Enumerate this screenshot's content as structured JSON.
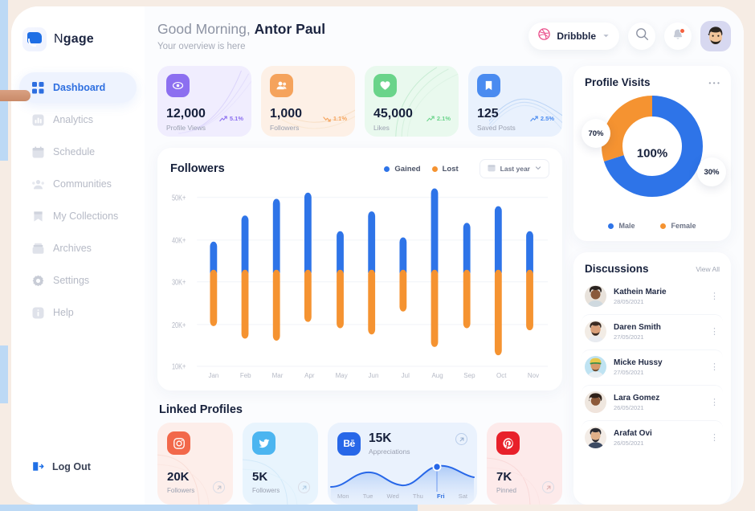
{
  "brand": {
    "name_light": "N",
    "name_bold": "gage",
    "logo_icon": "cast-signal-icon"
  },
  "sidebar": {
    "items": [
      {
        "label": "Dashboard",
        "icon": "grid-icon",
        "active": true
      },
      {
        "label": "Analytics",
        "icon": "bar-chart-icon",
        "active": false
      },
      {
        "label": "Schedule",
        "icon": "calendar-icon",
        "active": false
      },
      {
        "label": "Communities",
        "icon": "people-icon",
        "active": false
      },
      {
        "label": "My Collections",
        "icon": "bookmark-icon",
        "active": false
      },
      {
        "label": "Archives",
        "icon": "archive-icon",
        "active": false
      },
      {
        "label": "Settings",
        "icon": "gear-icon",
        "active": false
      },
      {
        "label": "Help",
        "icon": "info-icon",
        "active": false
      }
    ],
    "logout": {
      "label": "Log Out",
      "icon": "logout-icon"
    }
  },
  "header": {
    "greeting_prefix": "Good Morning, ",
    "user_name": "Antor Paul",
    "subtitle": "Your overview is here",
    "source": {
      "label": "Dribbble",
      "icon": "dribbble-icon",
      "chevron": "chevron-down-icon"
    },
    "search_icon": "search-icon",
    "bell_icon": "bell-icon",
    "avatar": "user-avatar"
  },
  "stats": [
    {
      "value": "12,000",
      "label": "Profile Views",
      "delta": "5.1%",
      "trend": "up",
      "icon": "eye-icon",
      "bg": "#f0edfe",
      "icon_bg": "#8c6ff0",
      "accent": "#8c6ff0"
    },
    {
      "value": "1,000",
      "label": "Followers",
      "delta": "1.1%",
      "trend": "down",
      "icon": "users-icon",
      "bg": "#fdf0e6",
      "icon_bg": "#f5a35c",
      "accent": "#f5a35c"
    },
    {
      "value": "45,000",
      "label": "Likes",
      "delta": "2.1%",
      "trend": "up",
      "icon": "heart-icon",
      "bg": "#e9f9ee",
      "icon_bg": "#6ad48a",
      "accent": "#6ad48a"
    },
    {
      "value": "125",
      "label": "Saved Posts",
      "delta": "2.5%",
      "trend": "up",
      "icon": "bookmark-icon",
      "bg": "#e9f1fd",
      "icon_bg": "#4a8bf0",
      "accent": "#4a8bf0"
    }
  ],
  "followers_card": {
    "title": "Followers",
    "legend": [
      {
        "label": "Gained",
        "color": "#2e74e8"
      },
      {
        "label": "Lost",
        "color": "#f59331"
      }
    ],
    "range": {
      "label": "Last year",
      "icon": "calendar-icon",
      "chevron": "chevron-down-icon"
    }
  },
  "chart_data": {
    "type": "bar",
    "title": "Followers",
    "xlabel": "",
    "ylabel": "",
    "ylim": [
      10000,
      52000
    ],
    "yticks": [
      50000,
      40000,
      30000,
      20000,
      10000
    ],
    "ytick_labels": [
      "50K+",
      "40K+",
      "30K+",
      "20K+",
      "10K+"
    ],
    "grid": false,
    "legend_position": "top-right",
    "split_value": 32000,
    "categories": [
      "Jan",
      "Feb",
      "Mar",
      "Apr",
      "May",
      "Jun",
      "Jul",
      "Aug",
      "Sep",
      "Oct",
      "Nov"
    ],
    "series": [
      {
        "name": "Gained",
        "color": "#2e74e8",
        "values": [
          37500,
          43500,
          47500,
          49000,
          40000,
          44500,
          38500,
          50500,
          42000,
          46000,
          40000
        ]
      },
      {
        "name": "Lost",
        "color": "#f59331",
        "values": [
          20500,
          17500,
          17000,
          21500,
          20000,
          18500,
          24000,
          15500,
          20000,
          13500,
          19500
        ]
      }
    ]
  },
  "linked_profiles": {
    "title": "Linked Profiles",
    "items": [
      {
        "network": "Instagram",
        "icon": "instagram-icon",
        "value": "20K",
        "label": "Followers",
        "bg": "#fdeeea",
        "icon_bg": "#f2684a",
        "type": "small"
      },
      {
        "network": "Twitter",
        "icon": "twitter-icon",
        "value": "5K",
        "label": "Followers",
        "bg": "#e8f4fd",
        "icon_bg": "#4cb5f0",
        "type": "small"
      },
      {
        "network": "Behance",
        "icon": "behance-icon",
        "value": "15K",
        "label": "Appreciations",
        "bg": "#eaf2fd",
        "icon_bg": "#2767e8",
        "type": "wide",
        "days": [
          "Mon",
          "Tue",
          "Wed",
          "Thu",
          "Fri",
          "Sat"
        ],
        "active_day": "Fri"
      },
      {
        "network": "Pinterest",
        "icon": "pinterest-icon",
        "value": "7K",
        "label": "Pinned",
        "bg": "#fdeaea",
        "icon_bg": "#e8202a",
        "type": "small"
      }
    ]
  },
  "profile_visits": {
    "title": "Profile Visits",
    "more_icon": "more-horizontal-icon",
    "center_value": "100%",
    "segments": [
      {
        "label": "Male",
        "percent": "70%",
        "value": 70,
        "color": "#2e74e8"
      },
      {
        "label": "Female",
        "percent": "30%",
        "value": 30,
        "color": "#f59331"
      }
    ]
  },
  "discussions": {
    "title": "Discussions",
    "action_label": "View All",
    "items": [
      {
        "name": "Kathein Marie",
        "date": "28/05/2021",
        "avatar_bg": "#e8e2db",
        "skin": "#8a5a3c",
        "hair": "#2a2320"
      },
      {
        "name": "Daren Smith",
        "date": "27/05/2021",
        "avatar_bg": "#f2ece5",
        "skin": "#d9a07a",
        "hair": "#3b2b22"
      },
      {
        "name": "Micke Hussy",
        "date": "27/05/2021",
        "avatar_bg": "#bfe3f2",
        "skin": "#d79a6a",
        "hair": "#e8c84a"
      },
      {
        "name": "Lara Gomez",
        "date": "26/05/2021",
        "avatar_bg": "#efe7df",
        "skin": "#8d5a3a",
        "hair": "#2f2119"
      },
      {
        "name": "Arafat Ovi",
        "date": "26/05/2021",
        "avatar_bg": "#f3ece6",
        "skin": "#e0b089",
        "hair": "#2a2a30"
      }
    ],
    "row_more_icon": "more-vertical-icon"
  }
}
